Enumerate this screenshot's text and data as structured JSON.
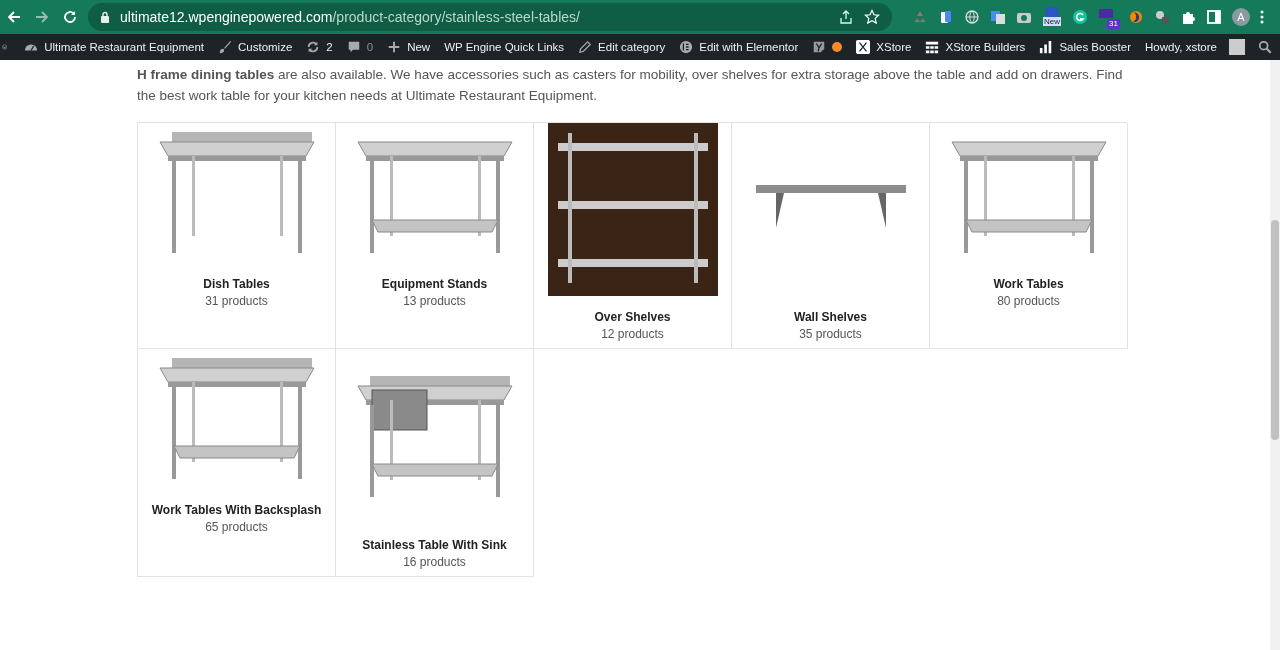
{
  "browser": {
    "url_host": "ultimate12.wpenginepowered.com",
    "url_path": "/product-category/stainless-steel-tables/",
    "extension_badges": [
      "New",
      "31"
    ],
    "profile_initial": "A"
  },
  "admin_bar": {
    "items": [
      {
        "kind": "site",
        "label": "Ultimate Restaurant Equipment"
      },
      {
        "kind": "customize",
        "label": "Customize"
      },
      {
        "kind": "updates",
        "label": "2"
      },
      {
        "kind": "comments",
        "label": "0"
      },
      {
        "kind": "new",
        "label": "New"
      },
      {
        "kind": "plain",
        "label": "WP Engine Quick Links"
      },
      {
        "kind": "edit",
        "label": "Edit category"
      },
      {
        "kind": "elementor",
        "label": "Edit with Elementor"
      },
      {
        "kind": "seo"
      },
      {
        "kind": "xstore",
        "label": "XStore"
      },
      {
        "kind": "builders",
        "label": "XStore Builders"
      },
      {
        "kind": "booster",
        "label": "Sales Booster"
      }
    ],
    "greeting": "Howdy, xstore"
  },
  "intro": "**H frame dining tables** are also available. We have accessories such as casters for mobility, over shelves for extra storage above the table and add on drawers.  Find the best work table for your kitchen needs at Ultimate Restaurant Equipment.",
  "categories": [
    {
      "name": "Dish Tables",
      "count": "31 products",
      "kind": "dish-table"
    },
    {
      "name": "Equipment Stands",
      "count": "13 products",
      "kind": "stand"
    },
    {
      "name": "Over Shelves",
      "count": "12 products",
      "kind": "over-shelf"
    },
    {
      "name": "Wall Shelves",
      "count": "35 products",
      "kind": "wall-shelf"
    },
    {
      "name": "Work Tables",
      "count": "80 products",
      "kind": "work-table"
    },
    {
      "name": "Work Tables With Backsplash",
      "count": "65 products",
      "kind": "backsplash-table"
    },
    {
      "name": "Stainless Table With Sink",
      "count": "16 products",
      "kind": "sink-table"
    }
  ]
}
